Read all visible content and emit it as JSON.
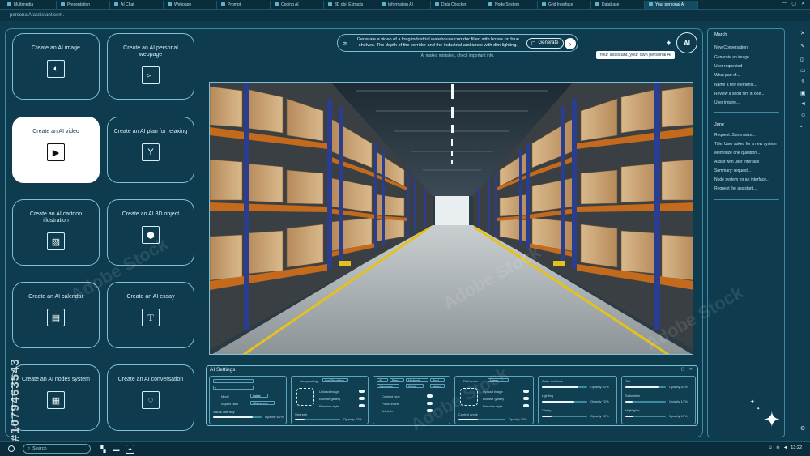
{
  "browser": {
    "tabs": [
      {
        "label": "Multimedia"
      },
      {
        "label": "Presentation"
      },
      {
        "label": "AI Chat"
      },
      {
        "label": "Webpage"
      },
      {
        "label": "Prompt"
      },
      {
        "label": "Coding AI"
      },
      {
        "label": "3D obj. Extracts"
      },
      {
        "label": "Information AI"
      },
      {
        "label": "Data Checker"
      },
      {
        "label": "Node System"
      },
      {
        "label": "Grid Interface"
      },
      {
        "label": "Database"
      },
      {
        "label": "Your personal AI"
      }
    ],
    "url": "personalAIassistant.com."
  },
  "tiles": [
    {
      "label": "Create an AI image",
      "icon": "image-icon",
      "glyph": "◐"
    },
    {
      "label": "Create an AI personal webpage",
      "icon": "terminal-icon",
      "glyph": ">_"
    },
    {
      "label": "Create an AI video",
      "icon": "play-icon",
      "glyph": "▶"
    },
    {
      "label": "Create an AI plan for relaxing",
      "icon": "cocktail-icon",
      "glyph": "Y"
    },
    {
      "label": "Create an AI cartoon illustration",
      "icon": "illustration-icon",
      "glyph": "▨"
    },
    {
      "label": "Create an AI 3D object",
      "icon": "cube-icon",
      "glyph": "⬢"
    },
    {
      "label": "Create an AI calendar",
      "icon": "calendar-icon",
      "glyph": "▤"
    },
    {
      "label": "Create an AI essay",
      "icon": "text-icon",
      "glyph": "T"
    },
    {
      "label": "Create an AI nodes system",
      "icon": "nodes-icon",
      "glyph": "▦"
    },
    {
      "label": "Create an AI conversation",
      "icon": "loading-icon",
      "glyph": "◌"
    }
  ],
  "prompt": {
    "text": "Generate a video of a long industrial warehouse corridor filled with boxes on blue shelves. The depth of the corridor and the industrial ambiance with dim lighting.",
    "generate_label": "Generate",
    "disclaimer": "AI makes mistakes, check important info.",
    "assistant_tip": "Your assistant, your own personal AI",
    "badge": "AI"
  },
  "settings": {
    "title": "AI Settings",
    "labels": {
      "compositing": "Compositing",
      "reference": "Reference",
      "color_tone": "Color and tone",
      "upload_image": "Upload image",
      "browse_gallery": "Browse gallery",
      "random_style": "Random style",
      "control_angle": "Control angle",
      "content_type": "Content type",
      "photo insert": "Photo insert",
      "art_style": "Art style",
      "lighting": "Lighting",
      "clarity": "Clarity",
      "tint": "Tint",
      "saturation": "Saturation",
      "highlights": "Highlights",
      "visual_intensity": "Visual intensity",
      "strength": "Strength",
      "mode": "Mode",
      "aspect_ratio": "Aspect ratio",
      "widescreen": "Widescreen",
      "low_resolution": "Low Resolution",
      "latest": "Latest",
      "opacity_81": "Opacity 81%",
      "opacity_72": "Opacity 72%",
      "opacity_22": "Opacity 22%",
      "opacity_17": "Opacity 17%",
      "opacity_19": "Opacity 19%",
      "opacity_42": "Opacity 42%"
    },
    "filter_chips": [
      "All",
      "Retro",
      "Modernist",
      "Pixel",
      "Vaporwave",
      "Moody",
      "Nature"
    ]
  },
  "sidebar": {
    "march_label": "March",
    "march_items": [
      "New Conversation",
      "Generate an image",
      "User requested",
      "What part of...",
      "Name a few elements...",
      "Review a short film in one...",
      "User inquire..."
    ],
    "june_label": "June",
    "june_items": [
      "Request: Summarize...",
      "Title: User asked for a new system",
      "Memorize one question...",
      "Assist with user interface",
      "Summary: request...",
      "Node system for an interface...",
      "Request the assistant..."
    ]
  },
  "taskbar": {
    "search_placeholder": "Search",
    "time": "13:22"
  },
  "watermark": {
    "id": "#1079463543",
    "brand": "Adobe Stock"
  },
  "colors": {
    "background": "#0e3b4d",
    "border": "#7fc0d4",
    "shelf_blue": "#2b3d8f",
    "shelf_orange": "#c46a1c",
    "floor_stripe": "#e5c21b"
  }
}
